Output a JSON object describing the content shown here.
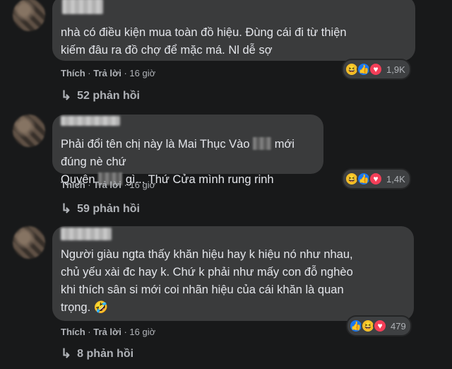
{
  "comments": [
    {
      "text_lines": [
        "nhà có điều kiện mua toàn đồ hiệu. Đùng cái đi từ thiện",
        "kiếm đâu ra đồ chợ để mặc má. Nl dễ sợ"
      ],
      "actions": {
        "like": "Thích",
        "reply": "Trả lời",
        "time": "16 giờ"
      },
      "reactions": {
        "icons": [
          "haha-icon",
          "like-icon",
          "love-icon"
        ],
        "count": "1,9K"
      },
      "replies": "52 phản hồi"
    },
    {
      "text_parts": [
        "Phải đổi tên chị này là Mai Thục Vào",
        "mới đúng nè chứ",
        "Quyên",
        "gì... Thứ Cửa mình rung rinh"
      ],
      "actions": {
        "like": "Thích",
        "reply": "Trả lời",
        "time": "16 giờ"
      },
      "reactions": {
        "icons": [
          "haha-icon",
          "like-icon",
          "love-icon"
        ],
        "count": "1,4K"
      },
      "replies": "59 phản hồi"
    },
    {
      "text_lines": [
        "Người giàu ngta thấy khăn hiệu hay k hiệu nó như nhau,",
        "chủ yếu xài đc hay k. Chứ k phải như mấy con đỗ nghèo",
        "khi thích sân si mới coi nhãn hiệu của cái khăn là quan",
        "trọng."
      ],
      "emoji": "🤣",
      "actions": {
        "like": "Thích",
        "reply": "Trả lời",
        "time": "16 giờ"
      },
      "reactions": {
        "icons": [
          "like-icon",
          "haha-icon",
          "love-icon"
        ],
        "count": "479"
      },
      "replies": "8 phản hồi"
    }
  ],
  "colors": {
    "background": "#18191a",
    "bubble": "#3a3b3c",
    "text": "#e4e6eb",
    "muted": "#b0b3b8",
    "like": "#1877f2",
    "love": "#f33e58",
    "haha": "#f7c52a"
  }
}
